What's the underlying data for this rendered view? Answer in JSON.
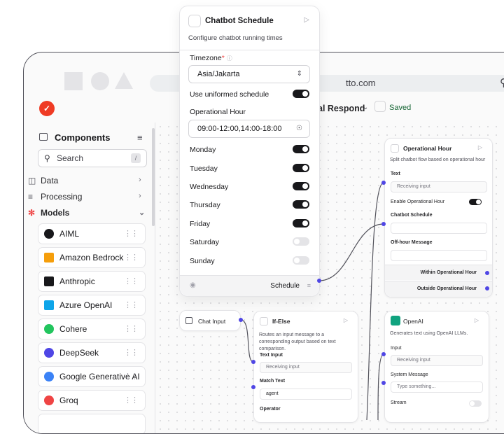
{
  "browser": {
    "url_fragment": "tto.com"
  },
  "appbar": {
    "flow_name": "al Respond",
    "saved_label": "Saved"
  },
  "sidebar": {
    "header": "Components",
    "search_placeholder": "Search",
    "search_key": "/",
    "categories": [
      {
        "label": "Data",
        "chevron": ">"
      },
      {
        "label": "Processing",
        "chevron": ">"
      },
      {
        "label": "Models",
        "chevron": "v"
      }
    ],
    "models": [
      {
        "label": "AIML",
        "color": "#18181b"
      },
      {
        "label": "Amazon Bedrock",
        "color": "#f59e0b"
      },
      {
        "label": "Anthropic",
        "color": "#18181b"
      },
      {
        "label": "Azure OpenAI",
        "color": "#0ea5e9"
      },
      {
        "label": "Cohere",
        "color": "#22c55e"
      },
      {
        "label": "DeepSeek",
        "color": "#4f46e5"
      },
      {
        "label": "Google Generative AI",
        "color": "#3b82f6"
      },
      {
        "label": "Groq",
        "color": "#ef4444"
      }
    ]
  },
  "popup": {
    "title": "Chatbot Schedule",
    "description": "Configure chatbot running times",
    "timezone_label": "Timezone",
    "timezone_value": "Asia/Jakarta",
    "uniform_label": "Use uniformed schedule",
    "hour_label": "Operational Hour",
    "hour_value": "09:00-12:00,14:00-18:00",
    "days": [
      {
        "label": "Monday",
        "on": true
      },
      {
        "label": "Tuesday",
        "on": true
      },
      {
        "label": "Wednesday",
        "on": true
      },
      {
        "label": "Thursday",
        "on": true
      },
      {
        "label": "Friday",
        "on": true
      },
      {
        "label": "Saturday",
        "on": false
      },
      {
        "label": "Sunday",
        "on": false
      }
    ],
    "footer_label": "Schedule"
  },
  "nodes": {
    "operational_hour": {
      "title": "Operational Hour",
      "desc": "Split chatbot flow based on operational hour",
      "text_label": "Text",
      "text_placeholder": "Receiving input",
      "enable_label": "Enable Operational Hour",
      "schedule_label": "Chatbot Schedule",
      "offhour_label": "Off-hour Message",
      "out_within": "Within Operational Hour",
      "out_outside": "Outside Operational Hour"
    },
    "chat_input": {
      "title": "Chat Input"
    },
    "if_else": {
      "title": "If-Else",
      "desc": "Routes an input message to a corresponding output based on text comparison.",
      "text_input_label": "Text Input",
      "text_input_placeholder": "Receiving input",
      "match_label": "Match Text",
      "match_value": "agent",
      "operator_label": "Operator"
    },
    "openai": {
      "title": "OpenAI",
      "desc": "Generates text using OpenAI LLMs.",
      "input_label": "Input",
      "input_placeholder": "Receiving input",
      "system_label": "System Message",
      "system_placeholder": "Type something...",
      "stream_label": "Stream"
    }
  }
}
